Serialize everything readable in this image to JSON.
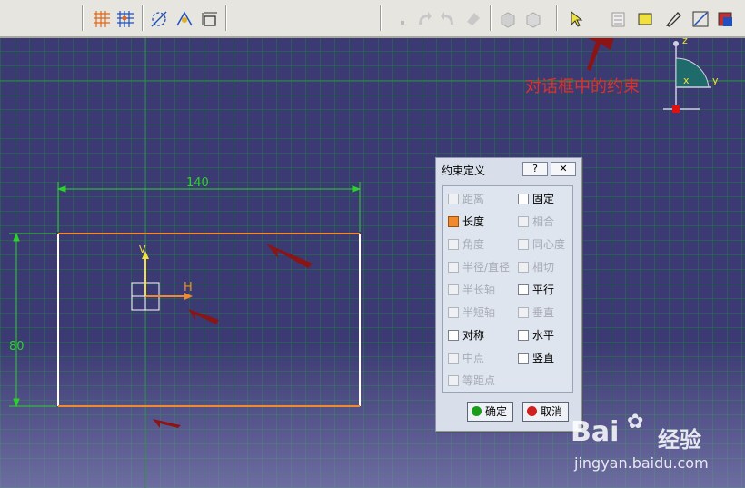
{
  "annotation": {
    "text": "对话框中的约束"
  },
  "sketch": {
    "width_dimension": "140",
    "height_dimension": "80",
    "axis_h_label": "H",
    "axis_v_label": "V"
  },
  "compass": {
    "z_label": "z",
    "x_label": "x",
    "y_label": "y"
  },
  "dialog": {
    "title": "约束定义",
    "help_label": "?",
    "close_label": "✕",
    "left_column": [
      {
        "label": "距离",
        "checked": false,
        "enabled": false
      },
      {
        "label": "长度",
        "checked": true,
        "enabled": true
      },
      {
        "label": "角度",
        "checked": false,
        "enabled": false
      },
      {
        "label": "半径/直径",
        "checked": false,
        "enabled": false
      },
      {
        "label": "半长轴",
        "checked": false,
        "enabled": false
      },
      {
        "label": "半短轴",
        "checked": false,
        "enabled": false
      },
      {
        "label": "对称",
        "checked": false,
        "enabled": true
      },
      {
        "label": "中点",
        "checked": false,
        "enabled": false
      },
      {
        "label": "等距点",
        "checked": false,
        "enabled": false
      }
    ],
    "right_column": [
      {
        "label": "固定",
        "checked": false,
        "enabled": true
      },
      {
        "label": "相合",
        "checked": false,
        "enabled": false
      },
      {
        "label": "同心度",
        "checked": false,
        "enabled": false
      },
      {
        "label": "相切",
        "checked": false,
        "enabled": false
      },
      {
        "label": "平行",
        "checked": false,
        "enabled": true
      },
      {
        "label": "垂直",
        "checked": false,
        "enabled": false
      },
      {
        "label": "水平",
        "checked": false,
        "enabled": true
      },
      {
        "label": "竖直",
        "checked": false,
        "enabled": true
      }
    ],
    "ok_label": "确定",
    "cancel_label": "取消"
  },
  "watermark": {
    "brand": "Bai",
    "brand2": "经验",
    "url": "jingyan.baidu.com"
  },
  "colors": {
    "background": "#3b3a72",
    "dimension": "#2ed02e",
    "selected_edge": "#f08a2c",
    "annotation": "#e0302a"
  }
}
